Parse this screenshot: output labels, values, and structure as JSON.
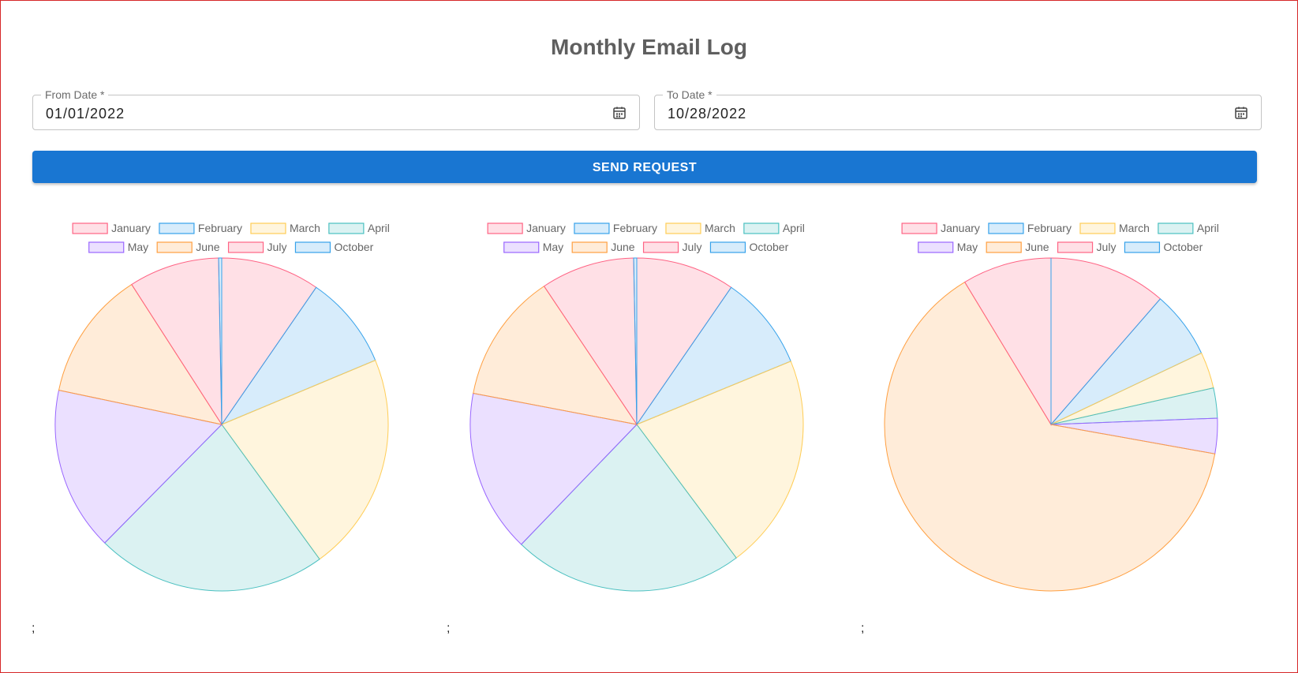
{
  "page": {
    "title": "Monthly Email Log"
  },
  "form": {
    "from_label": "From Date *",
    "from_value": "01/01/2022",
    "to_label": "To Date *",
    "to_value": "10/28/2022",
    "submit_label": "SEND REQUEST"
  },
  "icons": {
    "calendar": "calendar-icon"
  },
  "colors": {
    "frame_border": "#d62728",
    "button": "#1976d2",
    "title": "#5f5f5f"
  },
  "separators": [
    ";",
    ";",
    ";"
  ],
  "legend_palette": [
    {
      "border": "#ff6384",
      "fill": "rgba(255,99,132,0.2)"
    },
    {
      "border": "#36a2eb",
      "fill": "rgba(54,162,235,0.2)"
    },
    {
      "border": "#ffcd56",
      "fill": "rgba(255,205,86,0.2)"
    },
    {
      "border": "#4bc0c0",
      "fill": "rgba(75,192,192,0.2)"
    },
    {
      "border": "#9966ff",
      "fill": "rgba(153,102,255,0.2)"
    },
    {
      "border": "#ff9f40",
      "fill": "rgba(255,159,64,0.2)"
    },
    {
      "border": "#ff6384",
      "fill": "rgba(255,99,132,0.2)"
    },
    {
      "border": "#36a2eb",
      "fill": "rgba(54,162,235,0.2)"
    }
  ],
  "chart_data": [
    {
      "type": "pie",
      "categories": [
        "January",
        "February",
        "March",
        "April",
        "May",
        "June",
        "July",
        "October"
      ],
      "values": [
        9.6,
        9.1,
        21.3,
        22.4,
        15.9,
        12.6,
        8.8,
        0.3
      ],
      "legend_position": "top"
    },
    {
      "type": "pie",
      "categories": [
        "January",
        "February",
        "March",
        "April",
        "May",
        "June",
        "July",
        "October"
      ],
      "values": [
        9.6,
        9.2,
        21.0,
        22.4,
        15.8,
        12.6,
        9.1,
        0.3
      ],
      "legend_position": "top"
    },
    {
      "type": "pie",
      "categories": [
        "January",
        "February",
        "March",
        "April",
        "May",
        "June",
        "July",
        "October"
      ],
      "values": [
        11.3,
        6.5,
        3.5,
        2.9,
        3.4,
        63.0,
        8.6,
        0.0
      ],
      "legend_position": "top"
    }
  ]
}
